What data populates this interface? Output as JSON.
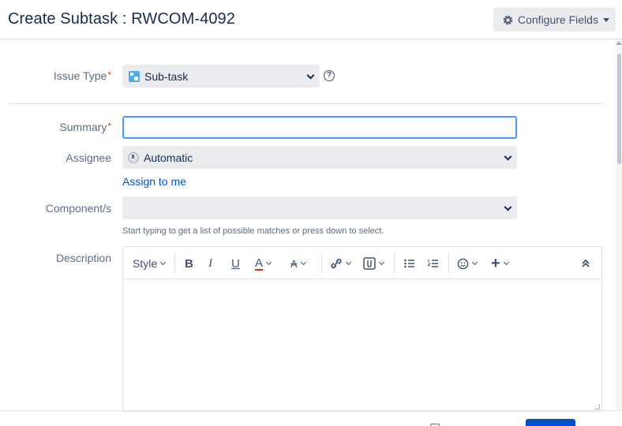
{
  "dialog": {
    "title": "Create Subtask : RWCOM-4092",
    "configure_label": "Configure Fields"
  },
  "fields": {
    "issue_type": {
      "label": "Issue Type",
      "required_mark": "*",
      "value": "Sub-task"
    },
    "summary": {
      "label": "Summary",
      "required_mark": "*",
      "value": ""
    },
    "assignee": {
      "label": "Assignee",
      "value": "Automatic",
      "assign_link": "Assign to me"
    },
    "components": {
      "label": "Component/s",
      "value": "",
      "hint": "Start typing to get a list of possible matches or press down to select."
    },
    "description": {
      "label": "Description"
    }
  },
  "editor_toolbar": {
    "style_label": "Style",
    "bold": "B",
    "italic": "I",
    "underline": "U",
    "text_color": "A",
    "more_format": "A",
    "add_icon": "+"
  },
  "colors": {
    "accent": "#0052cc",
    "focus": "#4c9aff",
    "required": "#de350b",
    "text_color_bar": "#de350b"
  }
}
